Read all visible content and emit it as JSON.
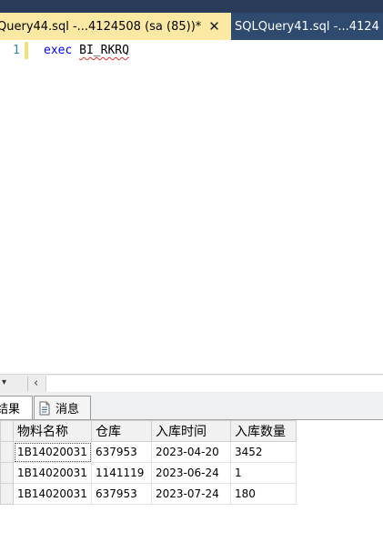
{
  "tabs": {
    "active": {
      "title": "Query44.sql -...4124508 (sa (85))*",
      "close": "✕"
    },
    "inactive": {
      "title": "SQLQuery41.sql -...4124"
    }
  },
  "editor": {
    "line_number": "1",
    "keyword": "exec",
    "procedure": "BI_RKRQ"
  },
  "scrollbar": {
    "zoom_arrow": "▾",
    "left_arrow": "‹"
  },
  "result_tabs": {
    "results": "结果",
    "messages": "消息"
  },
  "grid": {
    "headers": [
      "物料名称",
      "仓库",
      "入库时间",
      "入库数量"
    ],
    "rows": [
      [
        "1B14020031",
        "637953",
        "2023-04-20",
        "3452"
      ],
      [
        "1B14020031",
        "1141119",
        "2023-06-24",
        "1"
      ],
      [
        "1B14020031",
        "637953",
        "2023-07-24",
        "180"
      ]
    ]
  },
  "colors": {
    "tab_active_bg": "#fbe9a3",
    "tab_inactive_bg": "#2e4a6f",
    "keyword": "#0000ff",
    "line_number": "#2b91af"
  }
}
